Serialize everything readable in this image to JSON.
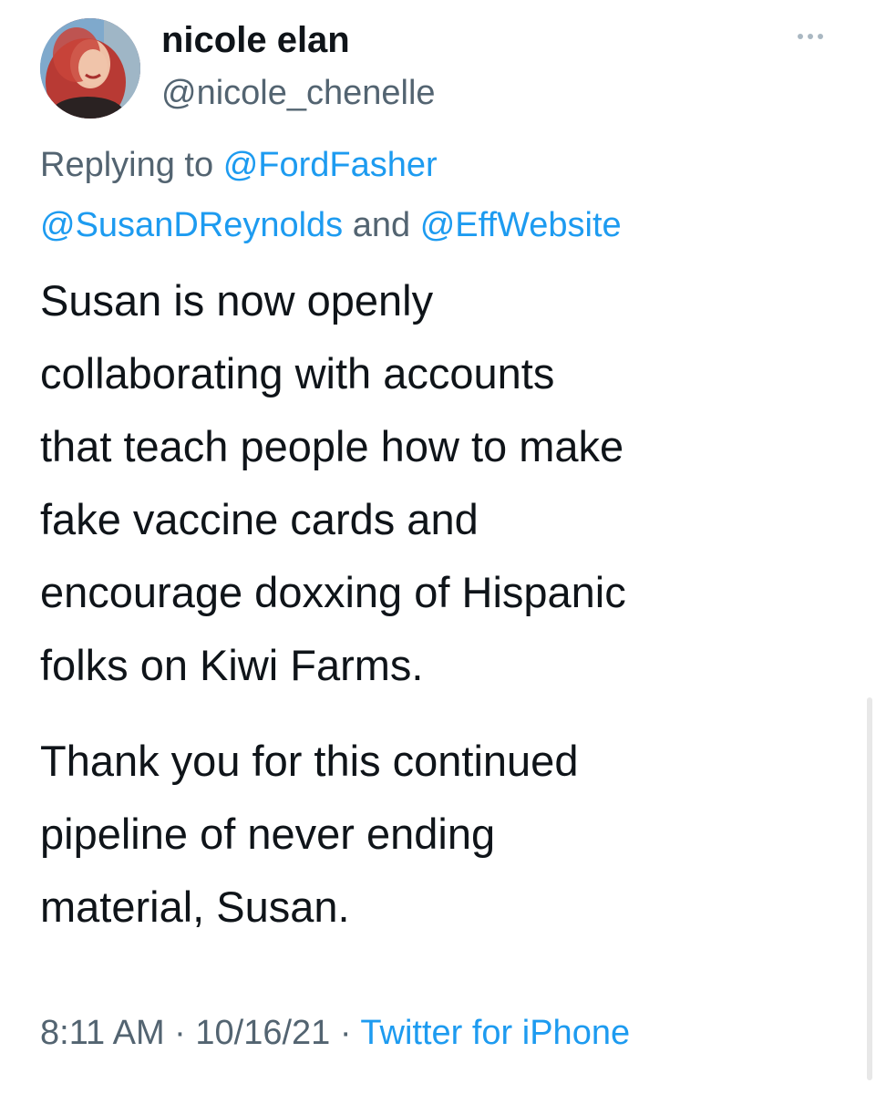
{
  "author": {
    "display_name": "nicole elan",
    "handle": "@nicole_chenelle"
  },
  "reply": {
    "prefix": "Replying to",
    "mention_1": "@FordFasher",
    "mention_2": "@SusanDReynolds",
    "conjunction": "and",
    "mention_3": "@EffWebsite"
  },
  "tweet": {
    "paragraph_1_lines": [
      "Susan is now openly",
      "collaborating with accounts",
      "that teach people how to make",
      "fake vaccine cards and",
      "encourage doxxing of Hispanic",
      "folks on Kiwi Farms."
    ],
    "paragraph_2_lines": [
      "Thank you for this continued",
      "pipeline of never ending",
      "material, Susan."
    ]
  },
  "meta": {
    "time": "8:11 AM",
    "separator": "·",
    "date": "10/16/21",
    "source": "Twitter for iPhone"
  },
  "icons": {
    "more": "more-horizontal-icon"
  },
  "colors": {
    "link": "#1d9bf0",
    "secondary_text": "#536471",
    "primary_text": "#0f1419"
  }
}
